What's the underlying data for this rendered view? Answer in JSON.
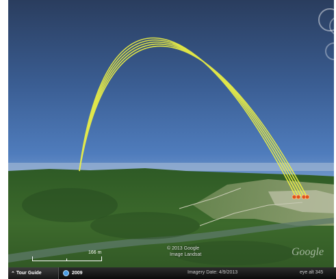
{
  "map": {
    "copyright_line1": "© 2013 Google",
    "copyright_line2": "Image Landsat",
    "logo": "Google",
    "scale_label": "166 m"
  },
  "status_bar": {
    "tour_guide_label": "Tour Guide",
    "tour_guide_icon": "chevron-up-icon",
    "year": "2009",
    "imagery_date": "Imagery Date: 4/9/2013",
    "eye_alt": "eye alt  345"
  },
  "colors": {
    "trajectory": "#f2f542",
    "impact_marker": "#e0521c",
    "forest": "#3d6a2c",
    "sky_top": "#2a3d5e"
  }
}
